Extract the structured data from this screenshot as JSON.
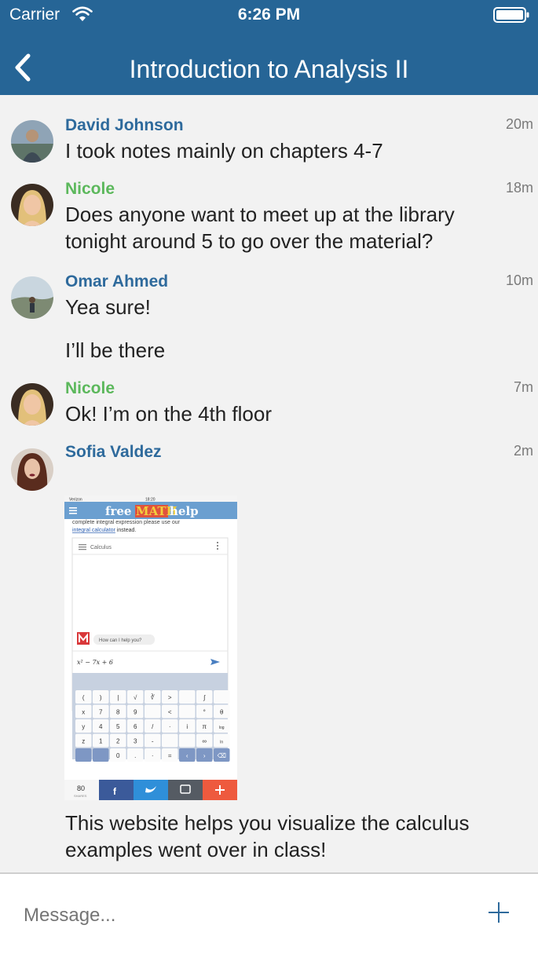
{
  "status_bar": {
    "carrier": "Carrier",
    "time": "6:26 PM"
  },
  "header": {
    "title": "Introduction to Analysis II"
  },
  "messages": [
    {
      "name": "David Johnson",
      "time": "20m",
      "lines": [
        "I took notes mainly on chapters 4-7"
      ]
    },
    {
      "name": "Nicole",
      "time": "18m",
      "lines": [
        "Does anyone want to meet up at the library tonight around 5 to go over the material?"
      ]
    },
    {
      "name": "Omar Ahmed",
      "time": "10m",
      "lines": [
        "Yea sure!",
        "I’ll be there"
      ]
    },
    {
      "name": "Nicole",
      "time": "7m",
      "lines": [
        "Ok! I’m on the 4th floor"
      ]
    },
    {
      "name": "Sofia Valdez",
      "time": "2m",
      "lines": [
        "This website helps you visualize the calculus examples went over in class!"
      ]
    }
  ],
  "attachment": {
    "status_carrier": "Verizon",
    "status_time": "18:20",
    "brand_a": "free",
    "brand_b": "MATH",
    "brand_c": "help",
    "page_text": "complete integral expression please use our",
    "link_text": "integral calculator",
    "link_suffix": " instead.",
    "widget_label": "Calculus",
    "bot_prompt": "How can I help you?",
    "expression": "x² − 7x + 6",
    "shares_count": "80",
    "shares_label": "SHARES"
  },
  "composer": {
    "placeholder": "Message..."
  },
  "colors": {
    "header": "#266596",
    "name_blue": "#2e6a9c",
    "name_green": "#5cb85c"
  }
}
